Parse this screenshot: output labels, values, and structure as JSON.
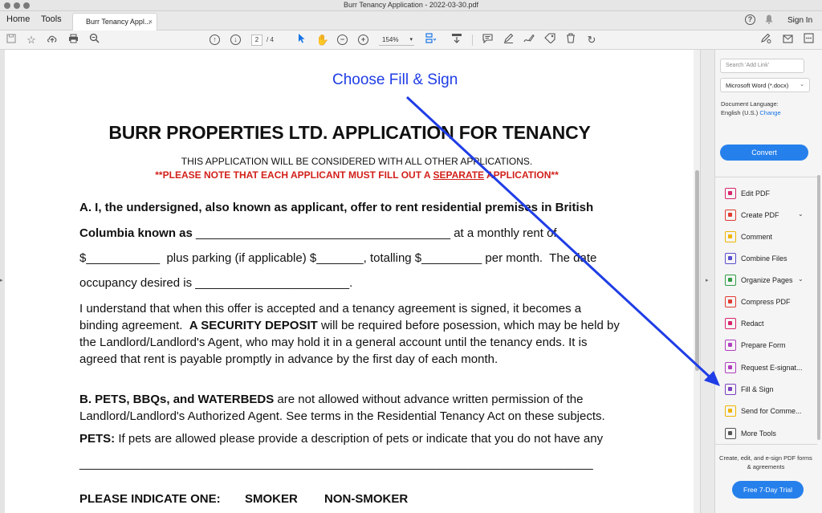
{
  "window": {
    "title": "Burr Tenancy Application - 2022-03-30.pdf"
  },
  "tabs": {
    "home": "Home",
    "tools": "Tools",
    "document_tab": "Burr Tenancy Appl...",
    "close_glyph": "×"
  },
  "header": {
    "help_glyph": "?",
    "signin": "Sign In"
  },
  "toolbar": {
    "current_page": "2",
    "page_total": "/ 4",
    "zoom": "154%"
  },
  "annotation": {
    "text": "Choose Fill & Sign",
    "color": "#1f3de6"
  },
  "document": {
    "title": "BURR PROPERTIES LTD. APPLICATION FOR TENANCY",
    "note1": "THIS APPLICATION WILL BE CONSIDERED WITH ALL OTHER APPLICATIONS.",
    "note2_a": "**PLEASE NOTE THAT EACH APPLICANT MUST FILL OUT A ",
    "note2_u": "SEPARATE",
    "note2_b": " APPLICATION**",
    "lineA1": "A. I, the undersigned, also known as applicant, offer to rent residential premises in British",
    "lineA2_bold": "Columbia known as",
    "lineA2_rest": " ______________________________________ at a monthly rent of",
    "lineA3": "$___________  plus parking (if applicable) $_______, totalling $_________ per month.  The date",
    "lineA4": "occupancy desired is _______________________.",
    "para1_l1": "I understand that when this offer is accepted and a tenancy agreement is signed, it becomes a",
    "para1_l2a": "binding agreement.  ",
    "para1_l2b": "A SECURITY DEPOSIT",
    "para1_l2c": " will be required before posession, which may be held by",
    "para1_l3": "the Landlord/Landlord's Agent, who may hold it in a general account until the tenancy ends. It is",
    "para1_l4": "agreed that rent is payable promptly in advance by the first day of each month.",
    "lineB1_bold": "B. PETS, BBQs, and WATERBEDS",
    "lineB1_rest": " are not allowed without advance written permission of the",
    "lineB2": "Landlord/Landlord's Authorized Agent. See terms in the Residential Tenancy Act on these subjects.",
    "pets_bold": "PETS:",
    "pets_rest": " If pets are allowed please provide a description of pets or indicate that you do not have any",
    "blank_line": "________________________________________________________________________________",
    "indicate": "PLEASE INDICATE ONE:",
    "smoker": "SMOKER",
    "nonsmoker": "NON-SMOKER"
  },
  "right_panel": {
    "search_placeholder": "Search 'Add Link'",
    "format": "Microsoft Word (*.docx)",
    "lang_label": "Document Language:",
    "lang_value": "English (U.S.)",
    "lang_change": "Change",
    "convert": "Convert",
    "tools": [
      {
        "label": "Edit PDF",
        "color": "#d9246c"
      },
      {
        "label": "Create PDF",
        "color": "#e03c31"
      },
      {
        "label": "Comment",
        "color": "#f0b400"
      },
      {
        "label": "Combine Files",
        "color": "#5a4fcf"
      },
      {
        "label": "Organize Pages",
        "color": "#2f9e44"
      },
      {
        "label": "Compress PDF",
        "color": "#e03c31"
      },
      {
        "label": "Redact",
        "color": "#d9246c"
      },
      {
        "label": "Prepare Form",
        "color": "#b23fc0"
      },
      {
        "label": "Request E-signat...",
        "color": "#b23fc0"
      },
      {
        "label": "Fill & Sign",
        "color": "#7b3fc0"
      },
      {
        "label": "Send for Comme...",
        "color": "#f0b400"
      },
      {
        "label": "More Tools",
        "color": "#555555"
      }
    ],
    "promo": "Create, edit, and e-sign PDF forms & agreements",
    "trial": "Free 7-Day Trial"
  }
}
